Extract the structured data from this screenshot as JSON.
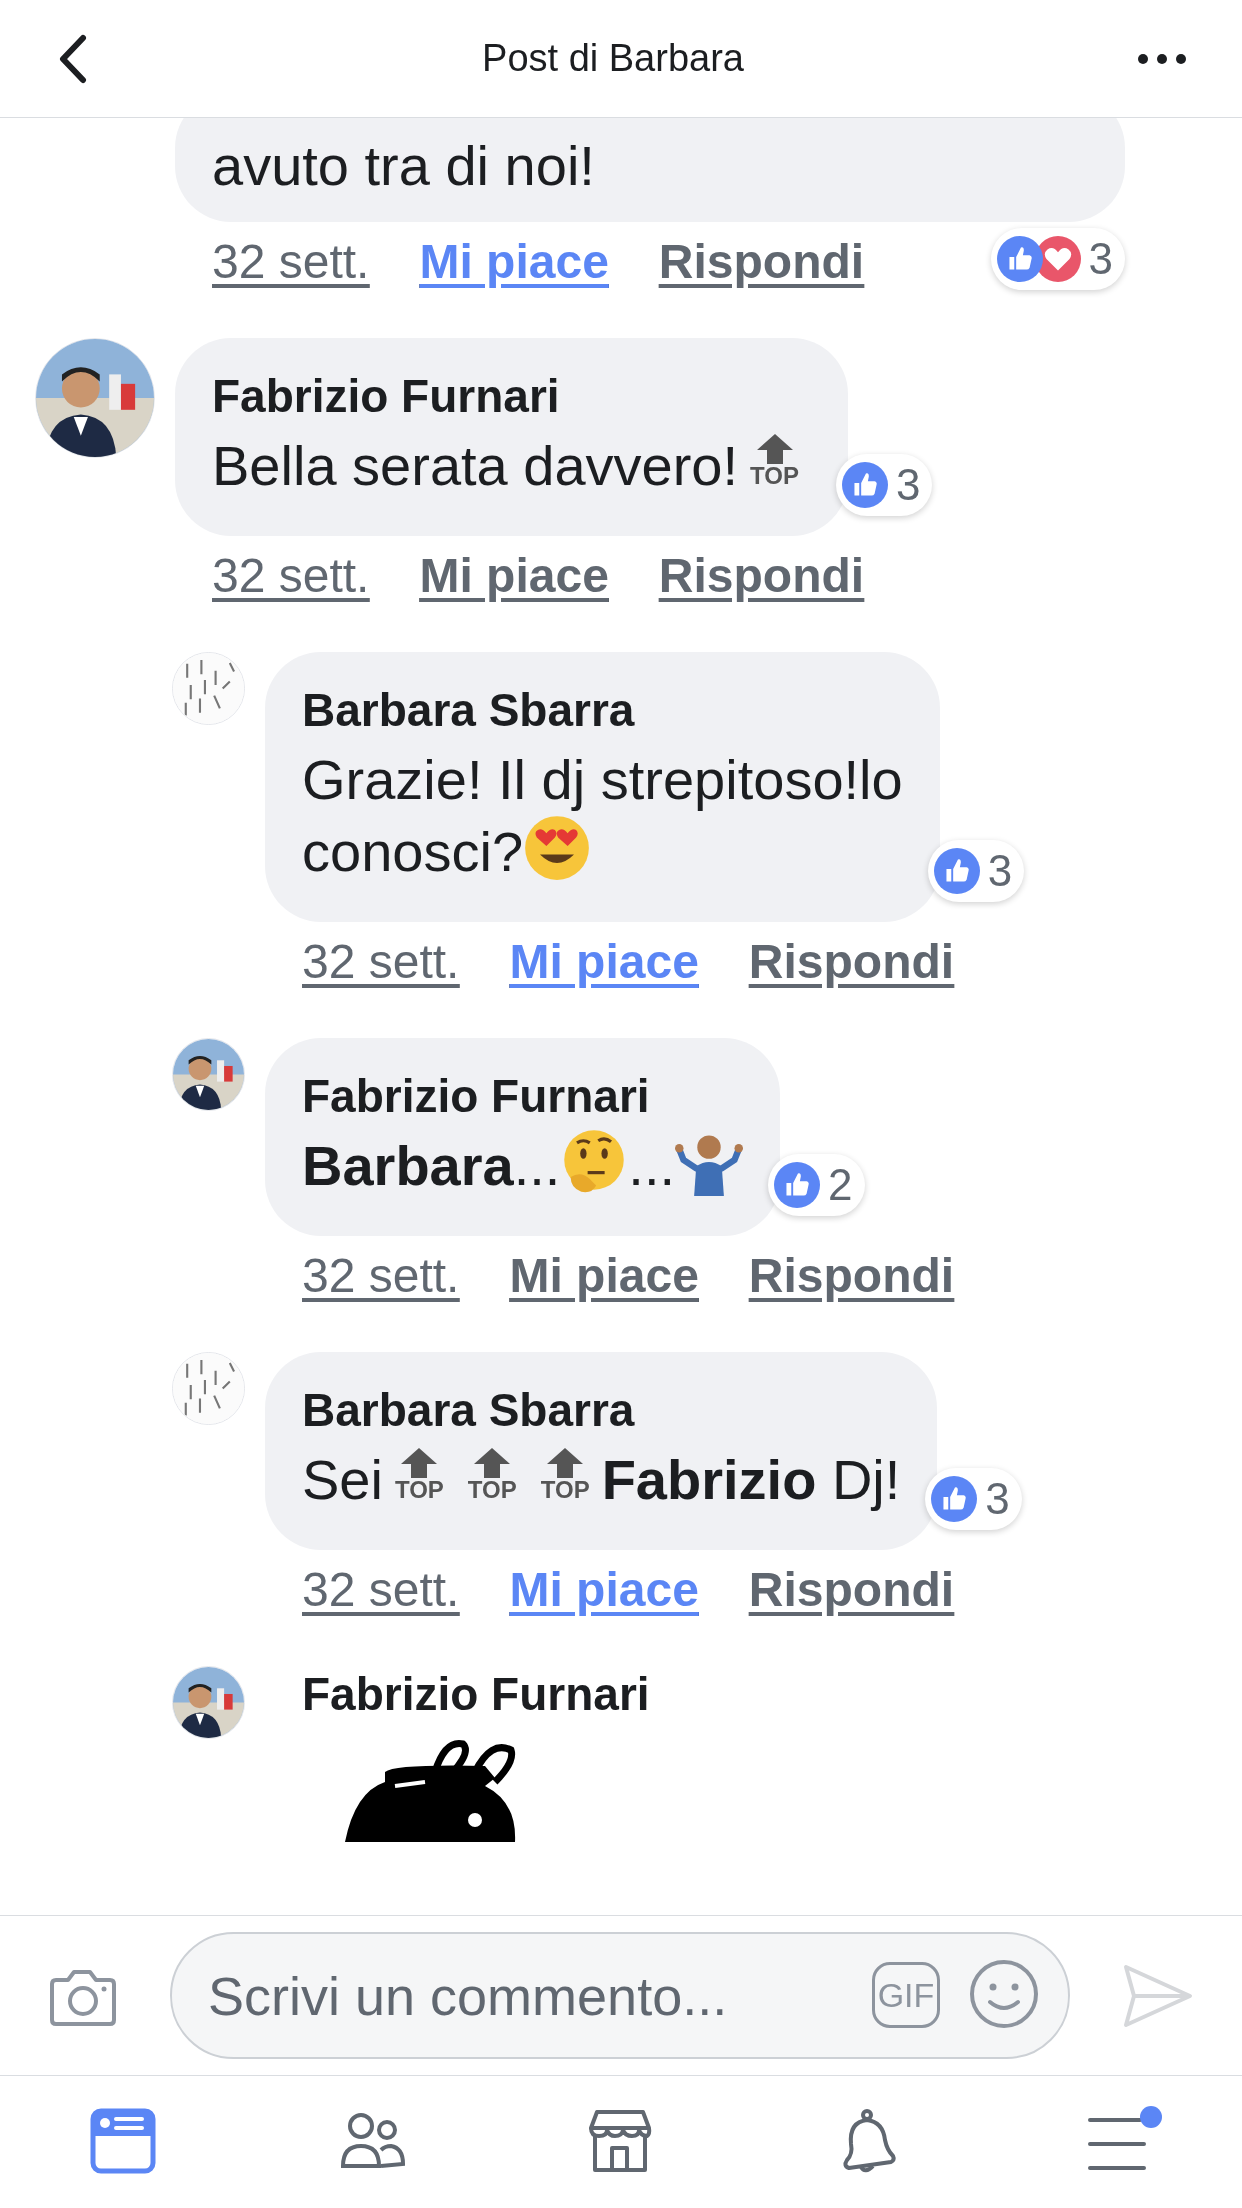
{
  "header": {
    "title": "Post di Barbara"
  },
  "comments": [
    {
      "body": [
        [
          {
            "kind": "text",
            "text": "avuto tra di noi!"
          }
        ]
      ],
      "reactions": {
        "types": [
          {
            "kind": "like"
          },
          {
            "kind": "love"
          }
        ],
        "count": "3"
      },
      "time": "32 sett.",
      "like": {
        "label": "Mi piace",
        "selected": true
      },
      "reply": "Rispondi"
    },
    {
      "author": "Fabrizio Furnari",
      "avatar": {
        "kind": "portrait"
      },
      "body": [
        [
          {
            "kind": "text",
            "text": "Bella serata davvero!"
          },
          {
            "kind": "top",
            "text": "TOP"
          }
        ]
      ],
      "reactions": {
        "types": [
          {
            "kind": "like"
          }
        ],
        "count": "3"
      },
      "time": "32 sett.",
      "like": {
        "label": "Mi piace",
        "selected": false
      },
      "reply": "Rispondi",
      "replies": [
        {
          "author": "Barbara Sbarra",
          "avatar": {
            "kind": "sketch"
          },
          "body": [
            [
              {
                "kind": "text",
                "text": "Grazie! Il dj strepitoso!lo"
              }
            ],
            [
              {
                "kind": "text",
                "text": "conosci?"
              },
              {
                "kind": "heart-eyes"
              }
            ]
          ],
          "reactions": {
            "types": [
              {
                "kind": "like"
              }
            ],
            "count": "3"
          },
          "time": "32 sett.",
          "like": {
            "label": "Mi piace",
            "selected": true
          },
          "reply": "Rispondi"
        },
        {
          "author": "Fabrizio Furnari",
          "avatar": {
            "kind": "portrait"
          },
          "body": [
            [
              {
                "kind": "text",
                "text": "**Barbara**..."
              },
              {
                "kind": "thinking"
              },
              {
                "kind": "text",
                "text": "..."
              },
              {
                "kind": "shrug"
              }
            ]
          ],
          "reactions": {
            "types": [
              {
                "kind": "like"
              }
            ],
            "count": "2"
          },
          "time": "32 sett.",
          "like": {
            "label": "Mi piace",
            "selected": false
          },
          "reply": "Rispondi"
        },
        {
          "author": "Barbara Sbarra",
          "avatar": {
            "kind": "sketch"
          },
          "body": [
            [
              {
                "kind": "text",
                "text": "Sei"
              },
              {
                "kind": "top",
                "text": "TOP"
              },
              {
                "kind": "top",
                "text": "TOP"
              },
              {
                "kind": "top",
                "text": "TOP"
              },
              {
                "kind": "text",
                "text": "**Fabrizio** Dj!"
              }
            ]
          ],
          "reactions": {
            "types": [
              {
                "kind": "like"
              }
            ],
            "count": "3"
          },
          "time": "32 sett.",
          "like": {
            "label": "Mi piace",
            "selected": true
          },
          "reply": "Rispondi"
        },
        {
          "author": "Fabrizio Furnari",
          "avatar": {
            "kind": "portrait"
          },
          "attachment": {
            "kind": "sticker"
          }
        }
      ]
    }
  ],
  "composer": {
    "placeholder": "Scrivi un commento...",
    "gif": "GIF"
  },
  "tabs": [
    {
      "kind": "feed",
      "selected": true
    },
    {
      "kind": "friends",
      "selected": false
    },
    {
      "kind": "marketplace",
      "selected": false
    },
    {
      "kind": "notifications",
      "selected": false
    },
    {
      "kind": "menu",
      "selected": false,
      "badge": true
    }
  ]
}
